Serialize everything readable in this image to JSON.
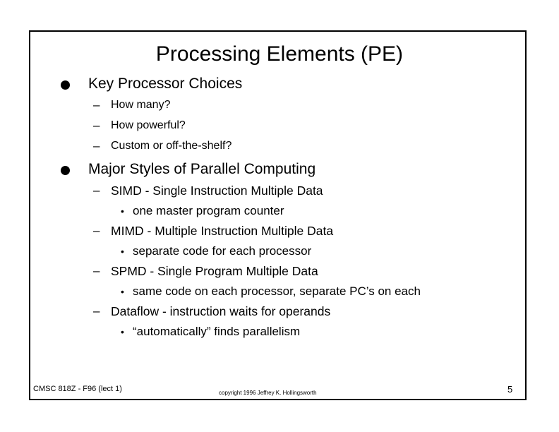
{
  "slide": {
    "title": "Processing Elements (PE)",
    "sections": [
      {
        "label": "Key Processor Choices",
        "items": [
          "How many?",
          "How powerful?",
          "Custom or off-the-shelf?"
        ]
      },
      {
        "label": "Major Styles of Parallel Computing",
        "items": [
          {
            "label": "SIMD - Single Instruction Multiple Data",
            "sub": "one master program counter"
          },
          {
            "label": "MIMD - Multiple Instruction Multiple Data",
            "sub": "separate code for each processor"
          },
          {
            "label": "SPMD - Single Program Multiple Data",
            "sub": "same code on each processor, separate PC’s on each"
          },
          {
            "label": "Dataflow - instruction waits for operands",
            "sub": "“automatically” finds parallelism"
          }
        ]
      }
    ]
  },
  "footer": {
    "course": "CMSC 818Z - F96  (lect 1)",
    "copyright": "copyright 1996  Jeffrey K. Hollingsworth",
    "page_number": "5"
  }
}
